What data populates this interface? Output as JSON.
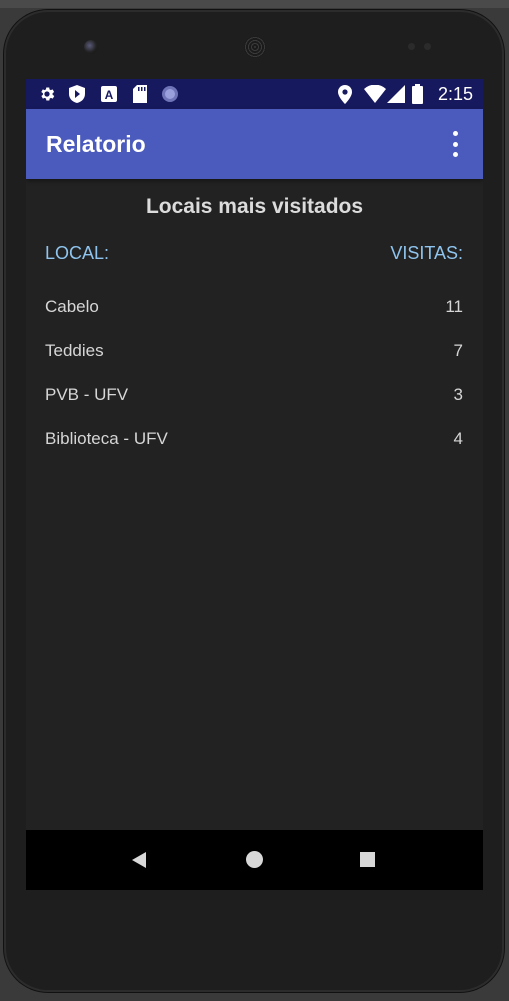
{
  "statusbar": {
    "time": "2:15",
    "left_icons": [
      "gear-icon",
      "shield-play-icon",
      "a-box-icon",
      "sd-card-icon",
      "sync-circle-icon"
    ],
    "right_icons": [
      "location-pin-icon",
      "wifi-icon",
      "signal-icon",
      "battery-icon"
    ],
    "color": "#17195e"
  },
  "appbar": {
    "title": "Relatorio",
    "menu_icon": "more-vert-icon",
    "color": "#4b5bbd"
  },
  "report": {
    "heading": "Locais mais visitados",
    "col_local": "LOCAL:",
    "col_visitas": "VISITAS:",
    "rows": [
      {
        "name": "Cabelo",
        "count": "11"
      },
      {
        "name": "Teddies",
        "count": "7"
      },
      {
        "name": "PVB - UFV",
        "count": "3"
      },
      {
        "name": "Biblioteca - UFV",
        "count": "4"
      }
    ]
  },
  "navbar": {
    "icons": [
      "back-icon",
      "home-icon",
      "recents-icon"
    ]
  }
}
